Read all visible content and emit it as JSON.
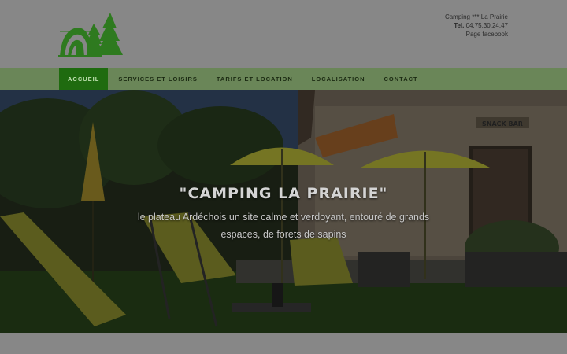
{
  "header": {
    "logo_icon": "camping-tent-trees-logo",
    "contact": {
      "camping_name": "Camping *** La Prairie",
      "tel_label": "Tel.",
      "tel_number": "04.75.30.24.47",
      "facebook_link": "Page facebook"
    }
  },
  "nav": {
    "items": [
      {
        "label": "ACCUEIL",
        "active": true
      },
      {
        "label": "SERVICES ET LOISIRS",
        "active": false
      },
      {
        "label": "TARIFS ET LOCATION",
        "active": false
      },
      {
        "label": "LOCALISATION",
        "active": false
      },
      {
        "label": "CONTACT",
        "active": false
      }
    ]
  },
  "hero": {
    "title": "\"CAMPING LA PRAIRIE\"",
    "subtitle": "le plateau Ardéchois un site calme et verdoyant, entouré de grands espaces, de forets de sapins",
    "sign_text": "SNACK BAR"
  },
  "colors": {
    "nav_bg": "#6a8658",
    "nav_active": "#1f6b0f",
    "logo_green": "#2e7d1e",
    "overlay": "#878787"
  }
}
